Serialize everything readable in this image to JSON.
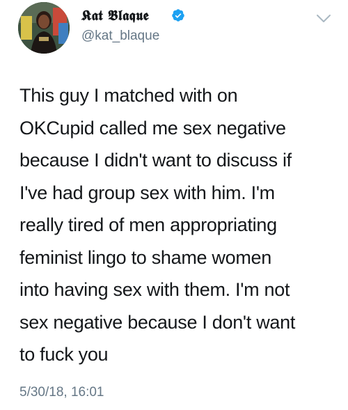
{
  "author": {
    "display_name": "𝕶𝖆𝖙 𝕭𝖑𝖆𝖖𝖚𝖊",
    "handle": "@kat_blaque",
    "verified": true,
    "avatar_icon": "profile-photo-icon"
  },
  "tweet": {
    "text": "This guy I matched with on\nOKCupid called me sex negative\nbecause I didn't want to discuss if\nI've had group sex with him. I'm\nreally tired of men appropriating\nfeminist lingo to shame women\ninto having sex with them. I'm not\nsex negative because I don't want\nto fuck you",
    "timestamp": "5/30/18, 16:01"
  },
  "icons": {
    "verified": "verified-badge-icon",
    "menu": "chevron-down-icon"
  },
  "colors": {
    "text_primary": "#14171a",
    "text_secondary": "#657786",
    "verified_blue": "#1da1f2",
    "chevron": "#aab8c2"
  }
}
